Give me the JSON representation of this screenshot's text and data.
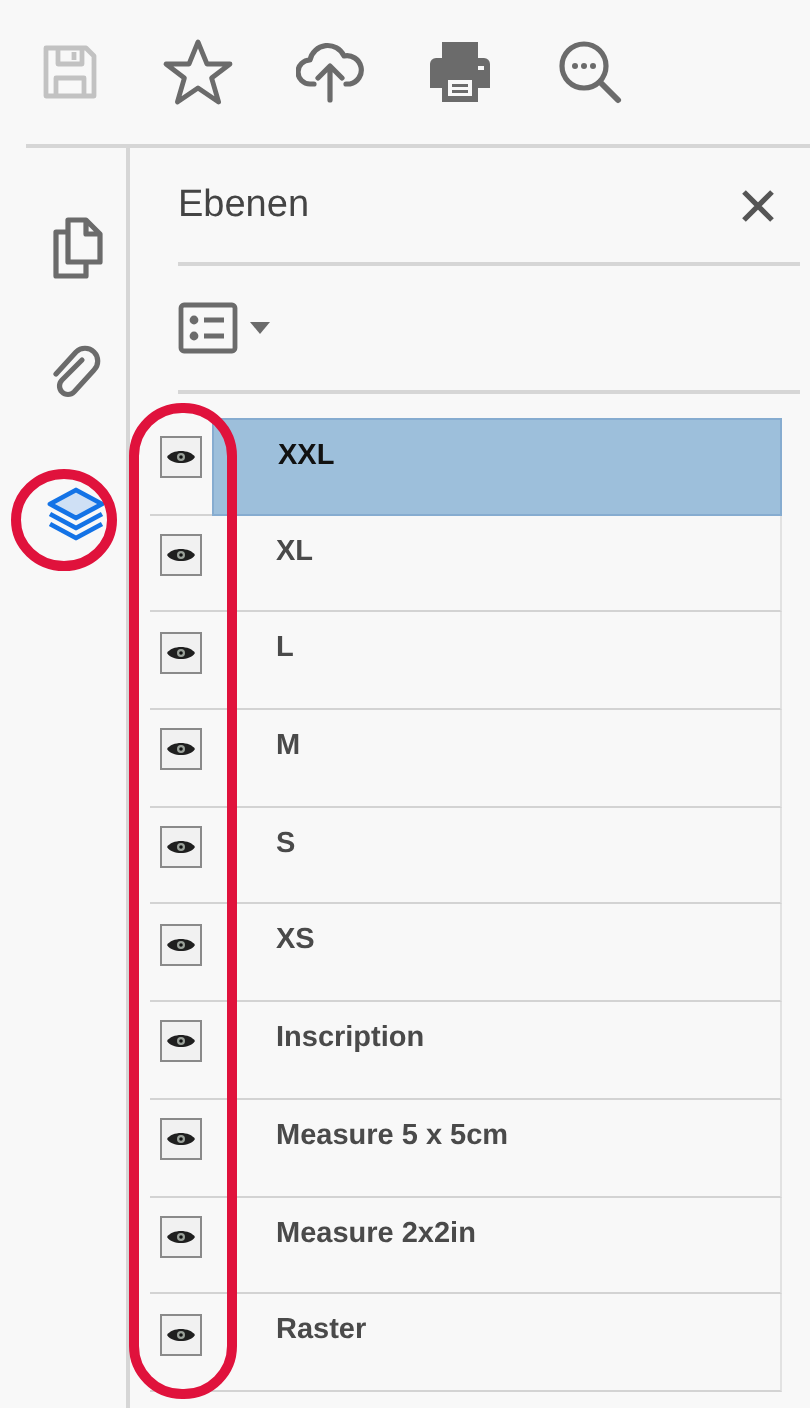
{
  "toolbar": [
    {
      "kind": "save",
      "disabled": true
    },
    {
      "kind": "bookmark",
      "disabled": false
    },
    {
      "kind": "upload",
      "disabled": false
    },
    {
      "kind": "print",
      "disabled": false
    },
    {
      "kind": "search",
      "disabled": false
    }
  ],
  "sidebar": {
    "items": [
      {
        "kind": "pages",
        "selected": false,
        "circled": false
      },
      {
        "kind": "attachments",
        "selected": false,
        "circled": false
      },
      {
        "kind": "layers",
        "selected": true,
        "circled": true
      }
    ]
  },
  "panel": {
    "title": "Ebenen",
    "visibility_column_circled": true,
    "layers": [
      {
        "name": "XXL",
        "visible": true,
        "selected": true
      },
      {
        "name": "XL",
        "visible": true,
        "selected": false
      },
      {
        "name": "L",
        "visible": true,
        "selected": false
      },
      {
        "name": "M",
        "visible": true,
        "selected": false
      },
      {
        "name": "S",
        "visible": true,
        "selected": false
      },
      {
        "name": "XS",
        "visible": true,
        "selected": false
      },
      {
        "name": "Inscription",
        "visible": true,
        "selected": false
      },
      {
        "name": "Measure 5 x 5cm",
        "visible": true,
        "selected": false
      },
      {
        "name": "Measure 2x2in",
        "visible": true,
        "selected": false
      },
      {
        "name": "Raster",
        "visible": true,
        "selected": false
      }
    ]
  }
}
